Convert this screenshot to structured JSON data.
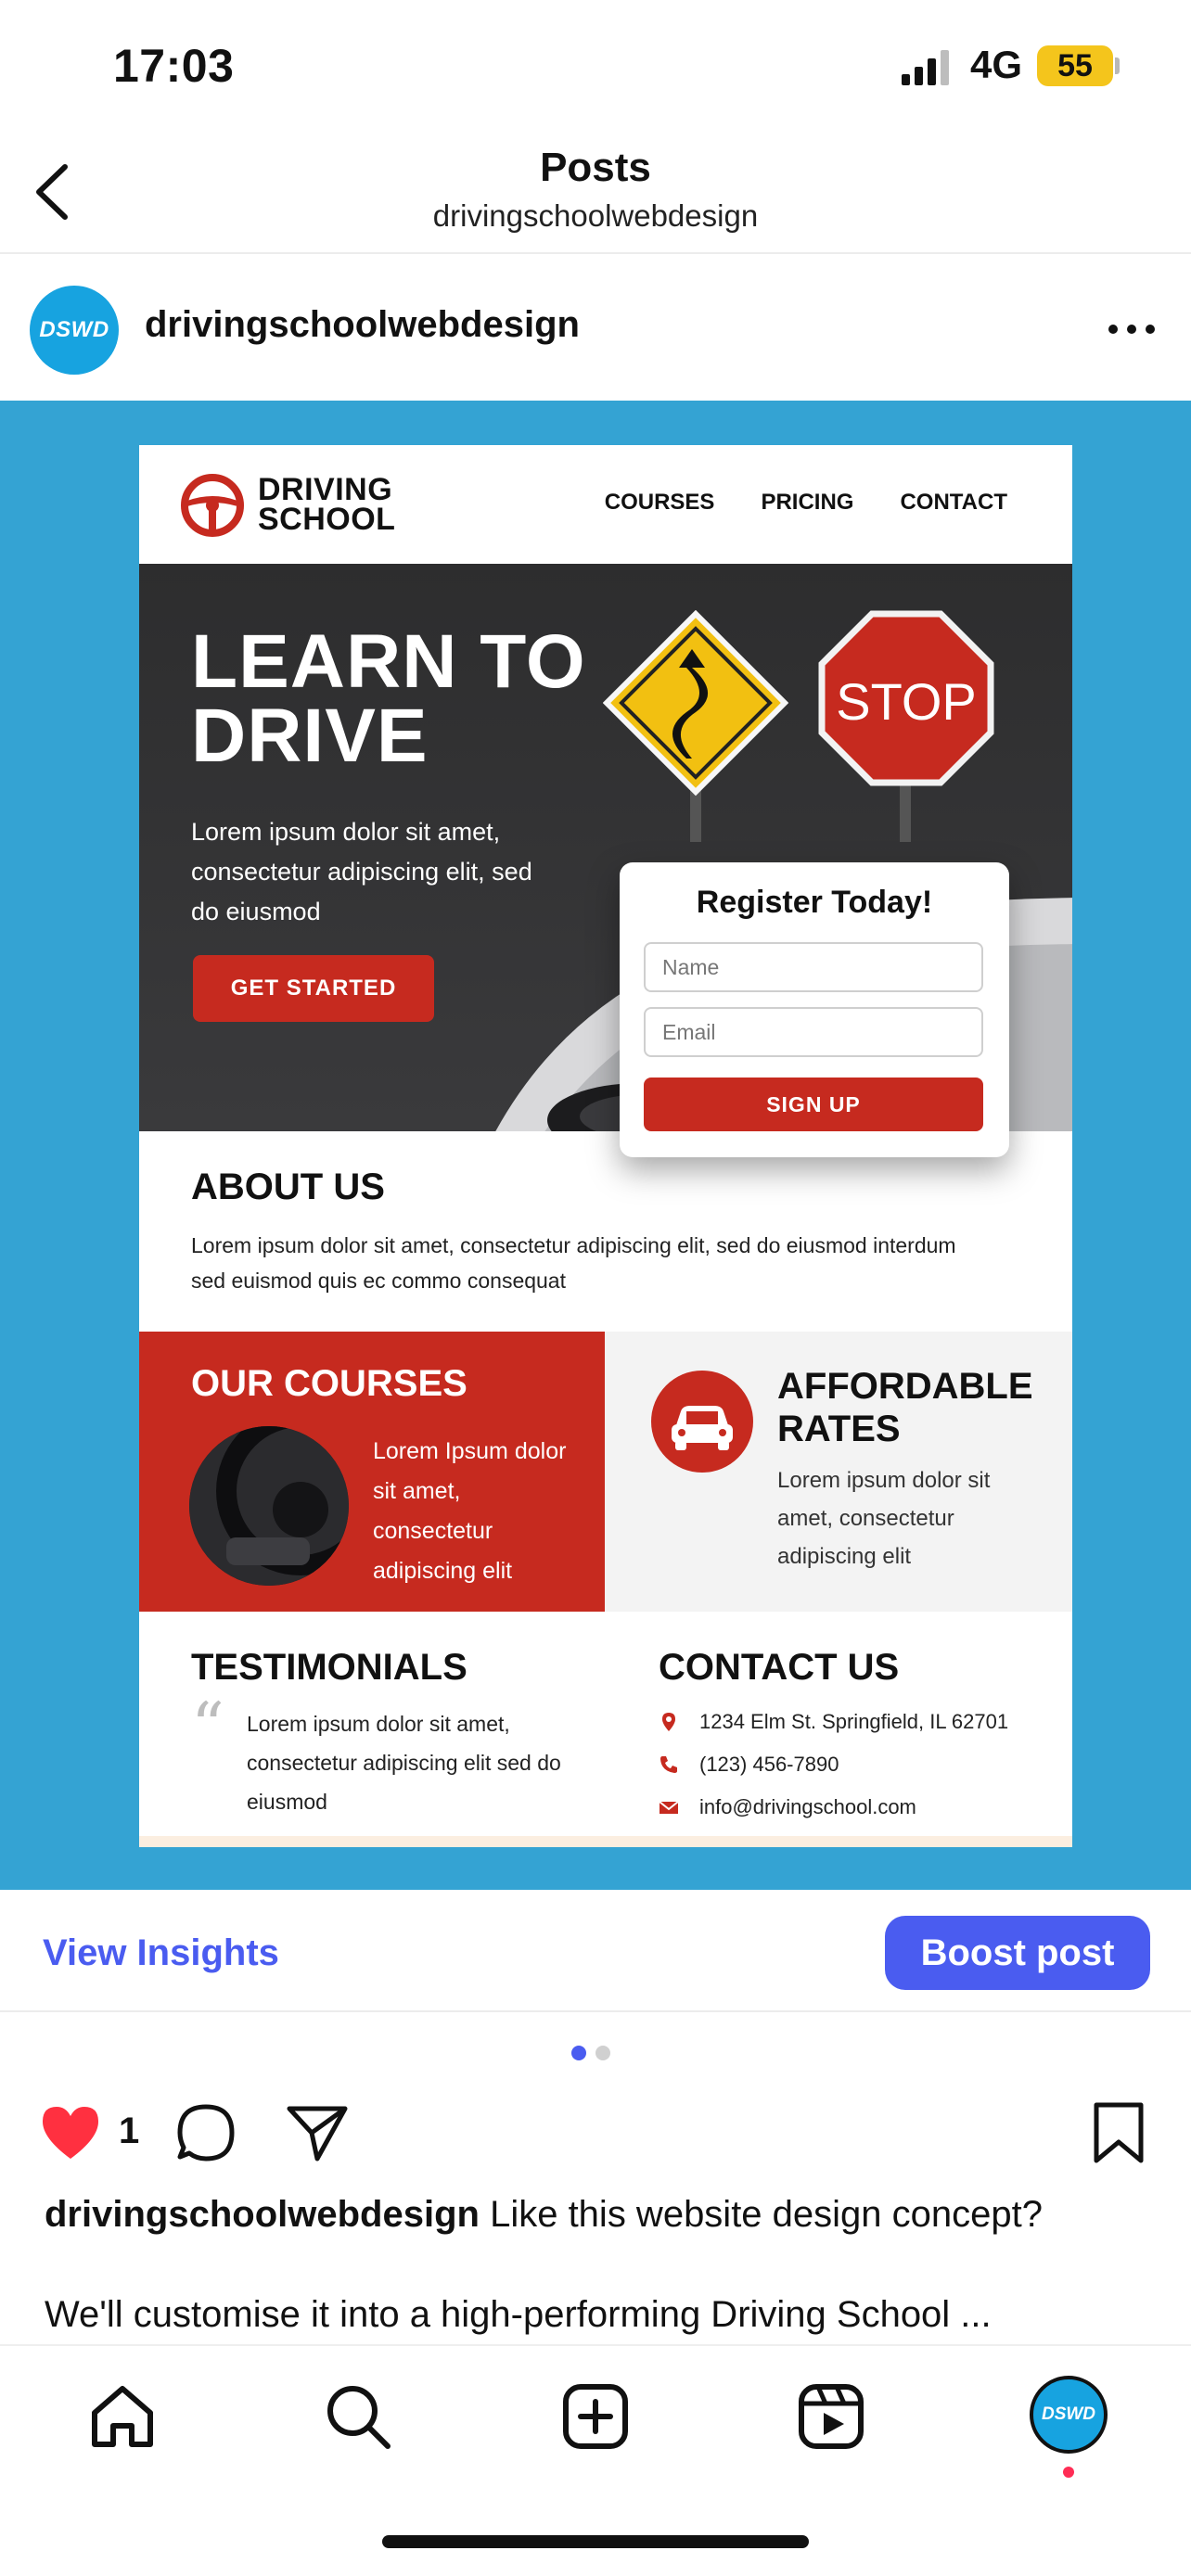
{
  "status_bar": {
    "time": "17:03",
    "network": "4G",
    "battery": "55"
  },
  "header": {
    "title": "Posts",
    "subtitle": "drivingschoolwebdesign"
  },
  "post": {
    "author": "drivingschoolwebdesign",
    "avatar_text": "DSWD",
    "image": {
      "logo_line1": "DRIVING",
      "logo_line2": "SCHOOL",
      "nav": [
        "COURSES",
        "PRICING",
        "CONTACT"
      ],
      "hero_title_1": "LEARN TO",
      "hero_title_2": "DRIVE",
      "hero_body": "Lorem ipsum dolor sit amet, consectetur adipiscing elit, sed do eiusmod",
      "hero_button": "GET STARTED",
      "stop_sign": "STOP",
      "register": {
        "title": "Register Today!",
        "name_placeholder": "Name",
        "email_placeholder": "Email",
        "button": "SIGN UP"
      },
      "about_title": "ABOUT US",
      "about_body": "Lorem ipsum dolor sit amet, consectetur adipiscing elit, sed do eiusmod interdum sed euismod quis ec commo consequat",
      "courses_title": "OUR COURSES",
      "courses_body": "Lorem Ipsum dolor sit amet, consectetur adipiscing elit",
      "rates_title_1": "AFFORDABLE",
      "rates_title_2": "RATES",
      "rates_body": "Lorem ipsum dolor sit amet, consectetur adipiscing elit",
      "testimonials_title": "TESTIMONIALS",
      "testimonials_body": "Lorem ipsum dolor sit amet, consectetur adipiscing elit sed do eiusmod",
      "contact_title": "CONTACT US",
      "contact_address": "1234 Elm St. Springfield, IL 62701",
      "contact_phone": "(123) 456-7890",
      "contact_email": "info@drivingschool.com"
    },
    "insights_label": "View Insights",
    "boost_label": "Boost post",
    "likes": "1",
    "caption_user": "drivingschoolwebdesign",
    "caption_text": "Like this website design concept?",
    "caption_line2": "We'll customise it into a high-performing Driving School ..."
  },
  "tab_bar": {
    "avatar_text": "DSWD"
  },
  "colors": {
    "accent": "#4a5cf0",
    "brand_red": "#c62a1f",
    "post_bg": "#34a3d3",
    "like": "#ff3040"
  },
  "icons": [
    "back-icon",
    "more-icon",
    "heart-icon",
    "comment-icon",
    "share-icon",
    "bookmark-icon",
    "home-icon",
    "search-icon",
    "create-icon",
    "reels-icon"
  ]
}
